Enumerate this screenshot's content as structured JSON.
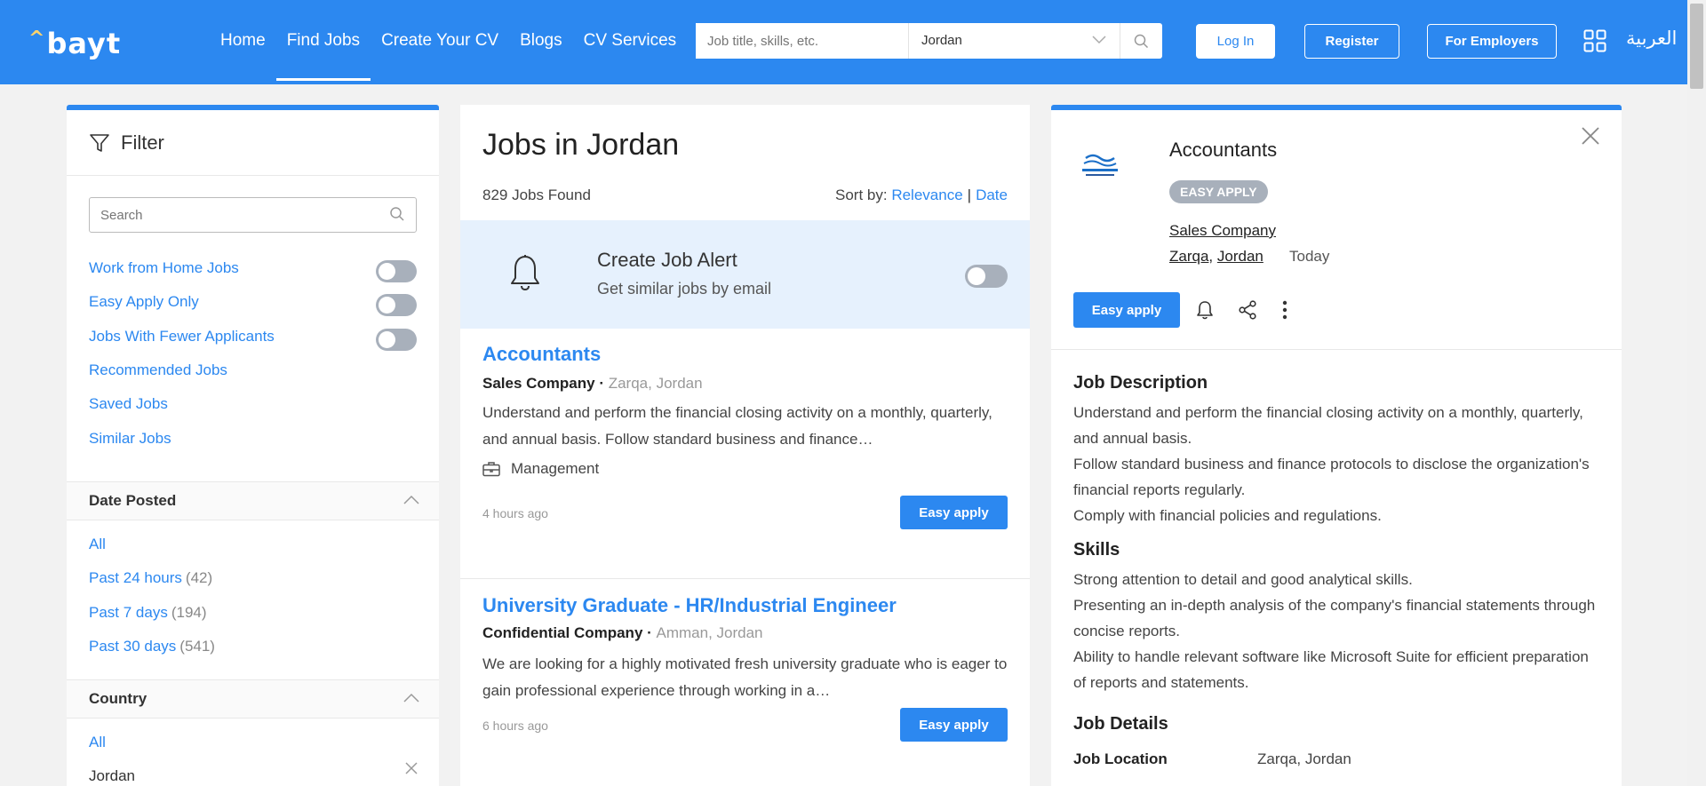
{
  "header": {
    "logo_text": "bayt",
    "nav": [
      "Home",
      "Find Jobs",
      "Create Your CV",
      "Blogs",
      "CV Services"
    ],
    "active_nav": "Find Jobs",
    "search_placeholder": "Job title, skills, etc.",
    "location_value": "Jordan",
    "login_label": "Log In",
    "register_label": "Register",
    "employers_label": "For Employers",
    "language_label": "العربية"
  },
  "filter": {
    "title": "Filter",
    "search_placeholder": "Search",
    "toggles": [
      "Work from Home Jobs",
      "Easy Apply Only",
      "Jobs With Fewer Applicants"
    ],
    "links": [
      "Recommended Jobs",
      "Saved Jobs",
      "Similar Jobs"
    ],
    "date_posted": {
      "title": "Date Posted",
      "options": [
        {
          "label": "All",
          "count": ""
        },
        {
          "label": "Past 24 hours",
          "count": "(42)"
        },
        {
          "label": "Past 7 days",
          "count": "(194)"
        },
        {
          "label": "Past 30 days",
          "count": "(541)"
        }
      ]
    },
    "country": {
      "title": "Country",
      "all_label": "All",
      "selected": "Jordan"
    }
  },
  "jobs": {
    "title": "Jobs in Jordan",
    "found": "829 Jobs Found",
    "sort_label": "Sort by:",
    "sort_relevance": "Relevance",
    "sort_separator": "|",
    "sort_date": "Date",
    "alert_title": "Create Job Alert",
    "alert_subtitle": "Get similar jobs by email",
    "items": [
      {
        "title": "Accountants",
        "company": "Sales Company",
        "separator": " · ",
        "location": "Zarqa, Jordan",
        "description": "Understand and perform the financial closing activity on a monthly, quarterly, and annual basis. Follow standard business and finance…",
        "category": "Management",
        "posted": "4 hours ago",
        "apply_label": "Easy apply"
      },
      {
        "title": "University Graduate - HR/Industrial Engineer",
        "company": "Confidential Company",
        "separator": " · ",
        "location": "Amman, Jordan",
        "description": "We are looking for a highly motivated fresh university graduate who is eager to gain professional experience through working in a…",
        "category": "",
        "posted": "6 hours ago",
        "apply_label": "Easy apply"
      }
    ]
  },
  "detail": {
    "title": "Accountants",
    "badge": "EASY APPLY",
    "company": "Sales Company",
    "city": "Zarqa",
    "country": "Jordan",
    "loc_separator": ", ",
    "date": "Today",
    "apply_label": "Easy apply",
    "description_heading": "Job Description",
    "description_lines": [
      "Understand and perform the financial closing activity on a monthly, quarterly, and annual basis.",
      "Follow standard business and finance protocols to disclose the organization's financial reports regularly.",
      "Comply with financial policies and regulations."
    ],
    "skills_heading": "Skills",
    "skills_lines": [
      "Strong attention to detail and good analytical skills.",
      "Presenting an in-depth analysis of the company's financial statements through concise reports.",
      "Ability to handle relevant software like Microsoft Suite for efficient preparation of reports and statements."
    ],
    "details_heading": "Job Details",
    "job_location_label": "Job Location",
    "job_location_value": "Zarqa, Jordan"
  },
  "colors": {
    "primary": "#2c88f0",
    "toggle_off": "#a8b0bb",
    "alert_bg": "#e6f1fd"
  }
}
